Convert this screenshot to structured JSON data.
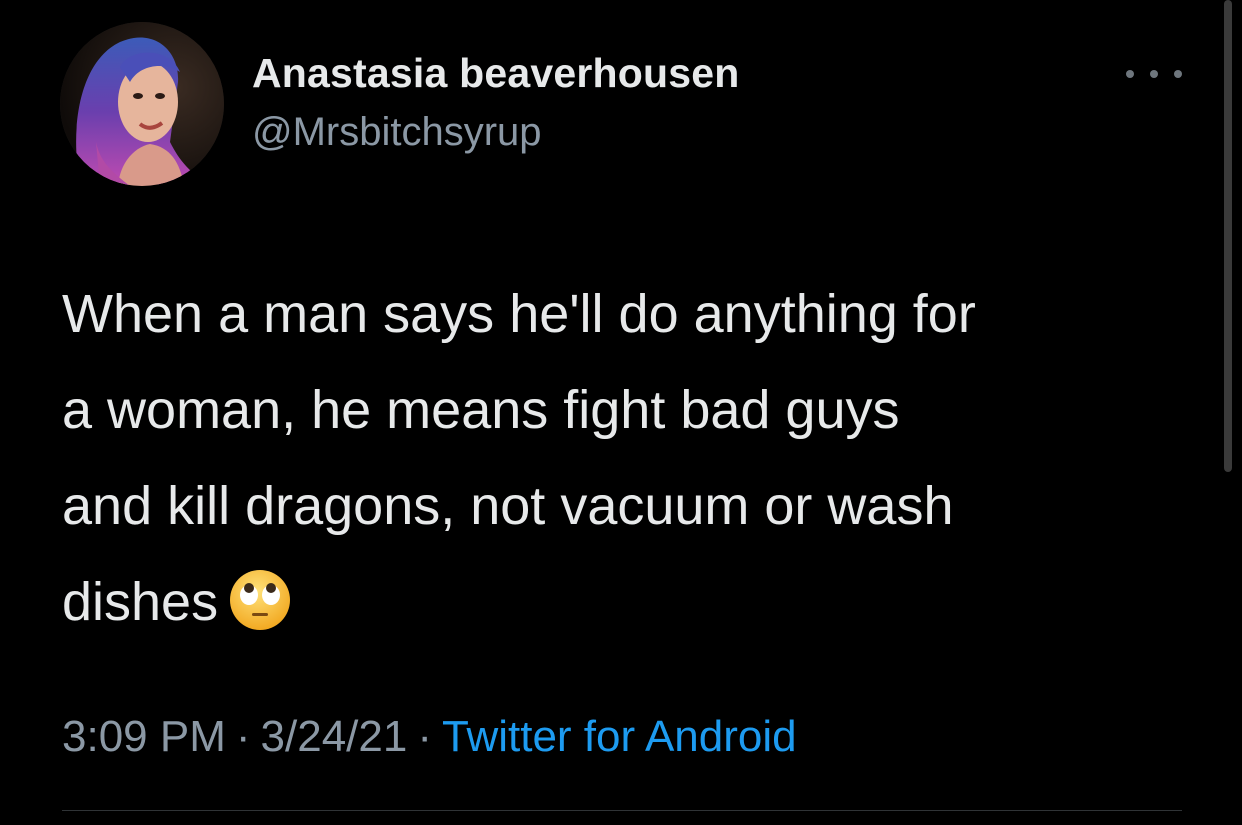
{
  "author": {
    "name": "Anastasia beaverhousen",
    "handle": "@Mrsbitchsyrup",
    "avatar_icon": "profile-photo"
  },
  "tweet": {
    "lines": [
      "When a man says he'll do anything for",
      "a woman, he means fight bad guys",
      "and kill dragons, not vacuum or wash",
      "dishes"
    ],
    "emoji": "face-with-rolling-eyes"
  },
  "meta": {
    "time": "3:09 PM",
    "separator": "·",
    "date": "3/24/21",
    "source": "Twitter for Android"
  },
  "icons": {
    "more": "more-horizontal-icon"
  },
  "colors": {
    "background": "#000000",
    "text": "#e7e9ea",
    "secondary": "#8b98a5",
    "link": "#1d9bf0"
  }
}
